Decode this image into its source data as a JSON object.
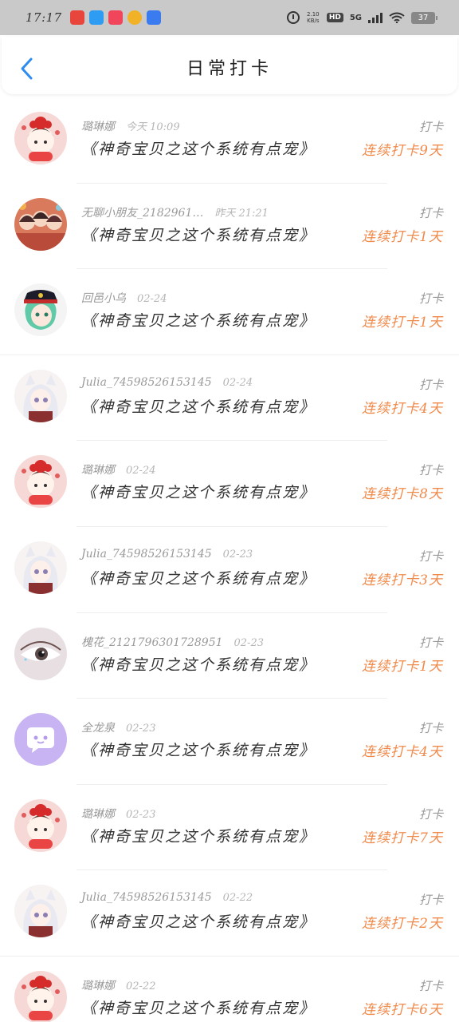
{
  "status_bar": {
    "time": "17:17",
    "net_speed_value": "2.10",
    "net_speed_unit": "KB/s",
    "hd": "HD",
    "network": "5G",
    "battery": "37",
    "app_icons": [
      {
        "icon": "app-icon-red",
        "color": "#e8453c"
      },
      {
        "icon": "app-icon-blue",
        "color": "#2e9cf2"
      },
      {
        "icon": "app-icon-pink",
        "color": "#f0455a"
      },
      {
        "icon": "app-icon-yellow",
        "color": "#f2b227"
      },
      {
        "icon": "app-icon-baidu",
        "color": "#3b7bf0"
      }
    ]
  },
  "header": {
    "title": "日常打卡",
    "back_icon": "chevron-left-icon",
    "accent_color": "#2e8cf0"
  },
  "entries": [
    {
      "user": "璐琳娜",
      "time": "今天 10:09",
      "title": "《神奇宝贝之这个系统有点宠》",
      "label": "打卡",
      "streak": "连续打卡9天",
      "avatar": "avatar-girl-red"
    },
    {
      "user": "无聊小朋友_2182961…",
      "time": "昨天 21:21",
      "title": "《神奇宝贝之这个系统有点宠》",
      "label": "打卡",
      "streak": "连续打卡1天",
      "avatar": "avatar-group"
    },
    {
      "user": "回邑小乌",
      "time": "02-24",
      "title": "《神奇宝贝之这个系统有点宠》",
      "label": "打卡",
      "streak": "连续打卡1天",
      "avatar": "avatar-green-hair"
    },
    {
      "user": "Julia_74598526153145",
      "time": "02-24",
      "title": "《神奇宝贝之这个系统有点宠》",
      "label": "打卡",
      "streak": "连续打卡4天",
      "avatar": "avatar-white-hair"
    },
    {
      "user": "璐琳娜",
      "time": "02-24",
      "title": "《神奇宝贝之这个系统有点宠》",
      "label": "打卡",
      "streak": "连续打卡8天",
      "avatar": "avatar-girl-red"
    },
    {
      "user": "Julia_74598526153145",
      "time": "02-23",
      "title": "《神奇宝贝之这个系统有点宠》",
      "label": "打卡",
      "streak": "连续打卡3天",
      "avatar": "avatar-white-hair"
    },
    {
      "user": "槐花_2121796301728951",
      "time": "02-23",
      "title": "《神奇宝贝之这个系统有点宠》",
      "label": "打卡",
      "streak": "连续打卡1天",
      "avatar": "avatar-eye"
    },
    {
      "user": "全龙泉",
      "time": "02-23",
      "title": "《神奇宝贝之这个系统有点宠》",
      "label": "打卡",
      "streak": "连续打卡4天",
      "avatar": "avatar-chat-bubble"
    },
    {
      "user": "璐琳娜",
      "time": "02-23",
      "title": "《神奇宝贝之这个系统有点宠》",
      "label": "打卡",
      "streak": "连续打卡7天",
      "avatar": "avatar-girl-red"
    },
    {
      "user": "Julia_74598526153145",
      "time": "02-22",
      "title": "《神奇宝贝之这个系统有点宠》",
      "label": "打卡",
      "streak": "连续打卡2天",
      "avatar": "avatar-white-hair"
    },
    {
      "user": "璐琳娜",
      "time": "02-22",
      "title": "《神奇宝贝之这个系统有点宠》",
      "label": "打卡",
      "streak": "连续打卡6天",
      "avatar": "avatar-girl-red"
    }
  ]
}
